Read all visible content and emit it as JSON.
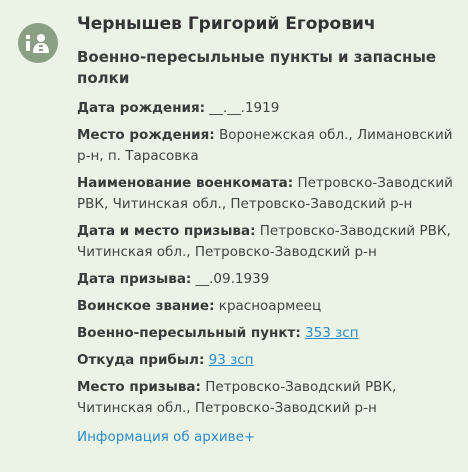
{
  "person": {
    "name": "Чернышев Григорий Егорович",
    "category": "Военно-пересыльные пункты и запасные полки",
    "icon": "person-document-icon"
  },
  "fields": {
    "birth_date": {
      "label": "Дата рождения:",
      "value": "__.__.1919"
    },
    "birth_place": {
      "label": "Место рождения:",
      "value": "Воронежская обл., Лимановский р-н, п. Тарасовка"
    },
    "commissariat": {
      "label": "Наименование военкомата:",
      "value": "Петровско-Заводский РВК, Читинская обл., Петровско-Заводский р-н"
    },
    "conscription_date_place": {
      "label": "Дата и место призыва:",
      "value": "Петровско-Заводский РВК, Читинская обл., Петровско-Заводский р-н"
    },
    "conscription_date": {
      "label": "Дата призыва:",
      "value": "__.09.1939"
    },
    "rank": {
      "label": "Воинское звание:",
      "value": "красноармеец"
    },
    "transit_point": {
      "label": "Военно-пересыльный пункт:",
      "value": "353 зсп"
    },
    "arrived_from": {
      "label": "Откуда прибыл:",
      "value": "93 зсп"
    },
    "conscription_place": {
      "label": "Место призыва:",
      "value": "Петровско-Заводский РВК, Читинская обл., Петровско-Заводский р-н"
    }
  },
  "archive_link": "Информация об архиве+",
  "colors": {
    "background": "#eaf3e6",
    "link": "#2f8bc9",
    "avatar": "#8a9f84"
  }
}
